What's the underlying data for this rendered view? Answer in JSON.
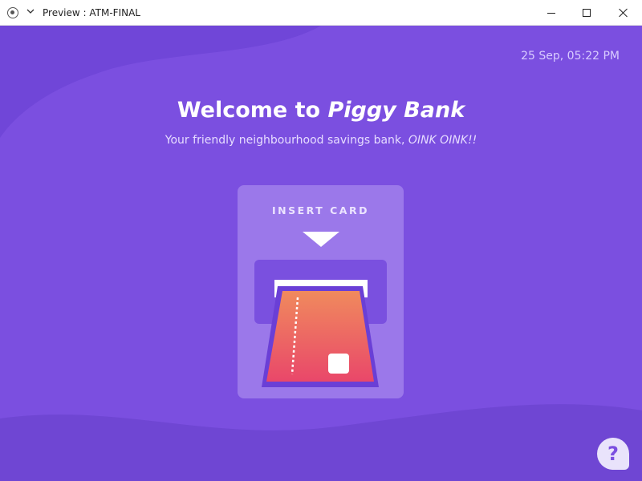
{
  "window": {
    "title": "Preview : ATM-FINAL"
  },
  "header": {
    "datetime": "25 Sep, 05:22 PM"
  },
  "welcome": {
    "prefix": "Welcome to ",
    "brand": "Piggy Bank",
    "tagline_prefix": "Your friendly neighbourhood savings bank, ",
    "tagline_emphasis": "OINK OINK!!"
  },
  "card_reader": {
    "label": "INSERT CARD"
  },
  "help": {
    "label": "?"
  },
  "colors": {
    "background": "#7b4fe0",
    "panel": "#9b78ea",
    "card_top": "#f08a5d",
    "card_bottom": "#e9476a"
  },
  "icons": [
    "app-icon",
    "chevron-down-icon",
    "minimize-icon",
    "maximize-icon",
    "close-icon",
    "arrow-down-icon",
    "credit-card-icon",
    "help-icon"
  ]
}
